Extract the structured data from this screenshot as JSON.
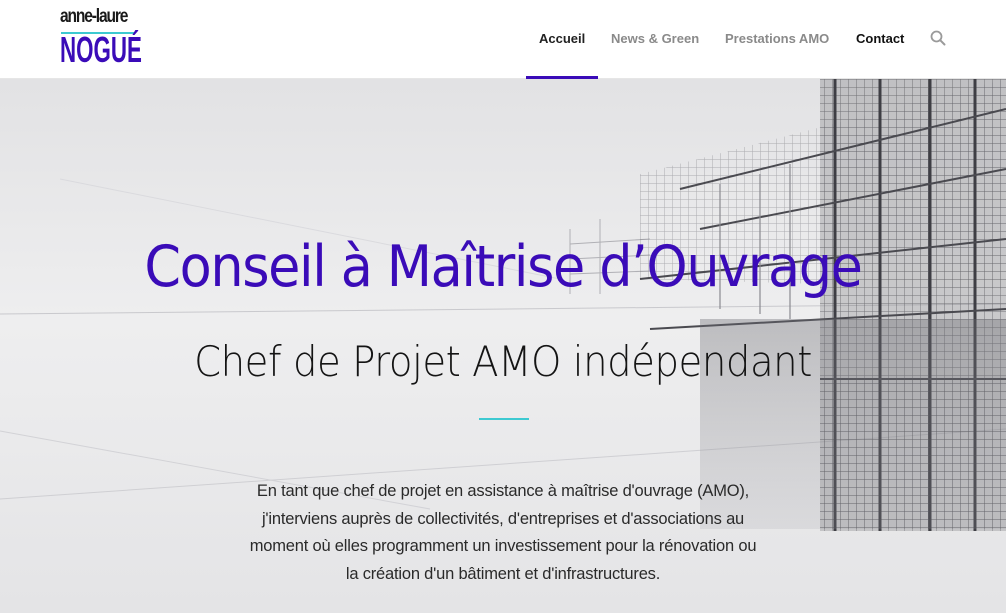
{
  "logo": {
    "top_text": "anne-laure",
    "bottom_text": "NOGUÉ",
    "colors": {
      "top": "#1a1a1a",
      "bottom": "#3a0bb8",
      "line": "#3dc9d1"
    }
  },
  "nav": {
    "items": [
      {
        "label": "Accueil",
        "active": true
      },
      {
        "label": "News & Green",
        "active": false
      },
      {
        "label": "Prestations AMO",
        "active": false
      },
      {
        "label": "Contact",
        "active": false
      }
    ],
    "search_icon": "search-icon"
  },
  "hero": {
    "title": "Conseil à Maîtrise d’Ouvrage",
    "subtitle": "Chef de Projet AMO indépendant",
    "body_lines": [
      "En tant que chef de projet en assistance à maîtrise d'ouvrage (AMO),",
      "j'interviens auprès de collectivités, d'entreprises et d'associations au",
      "moment où elles programment un investissement pour la rénovation ou",
      "la création d'un bâtiment et d'infrastructures."
    ]
  },
  "colors": {
    "accent": "#3a0bb8",
    "secondary_accent": "#3dc9d1",
    "nav_inactive": "#8a8a8a"
  }
}
